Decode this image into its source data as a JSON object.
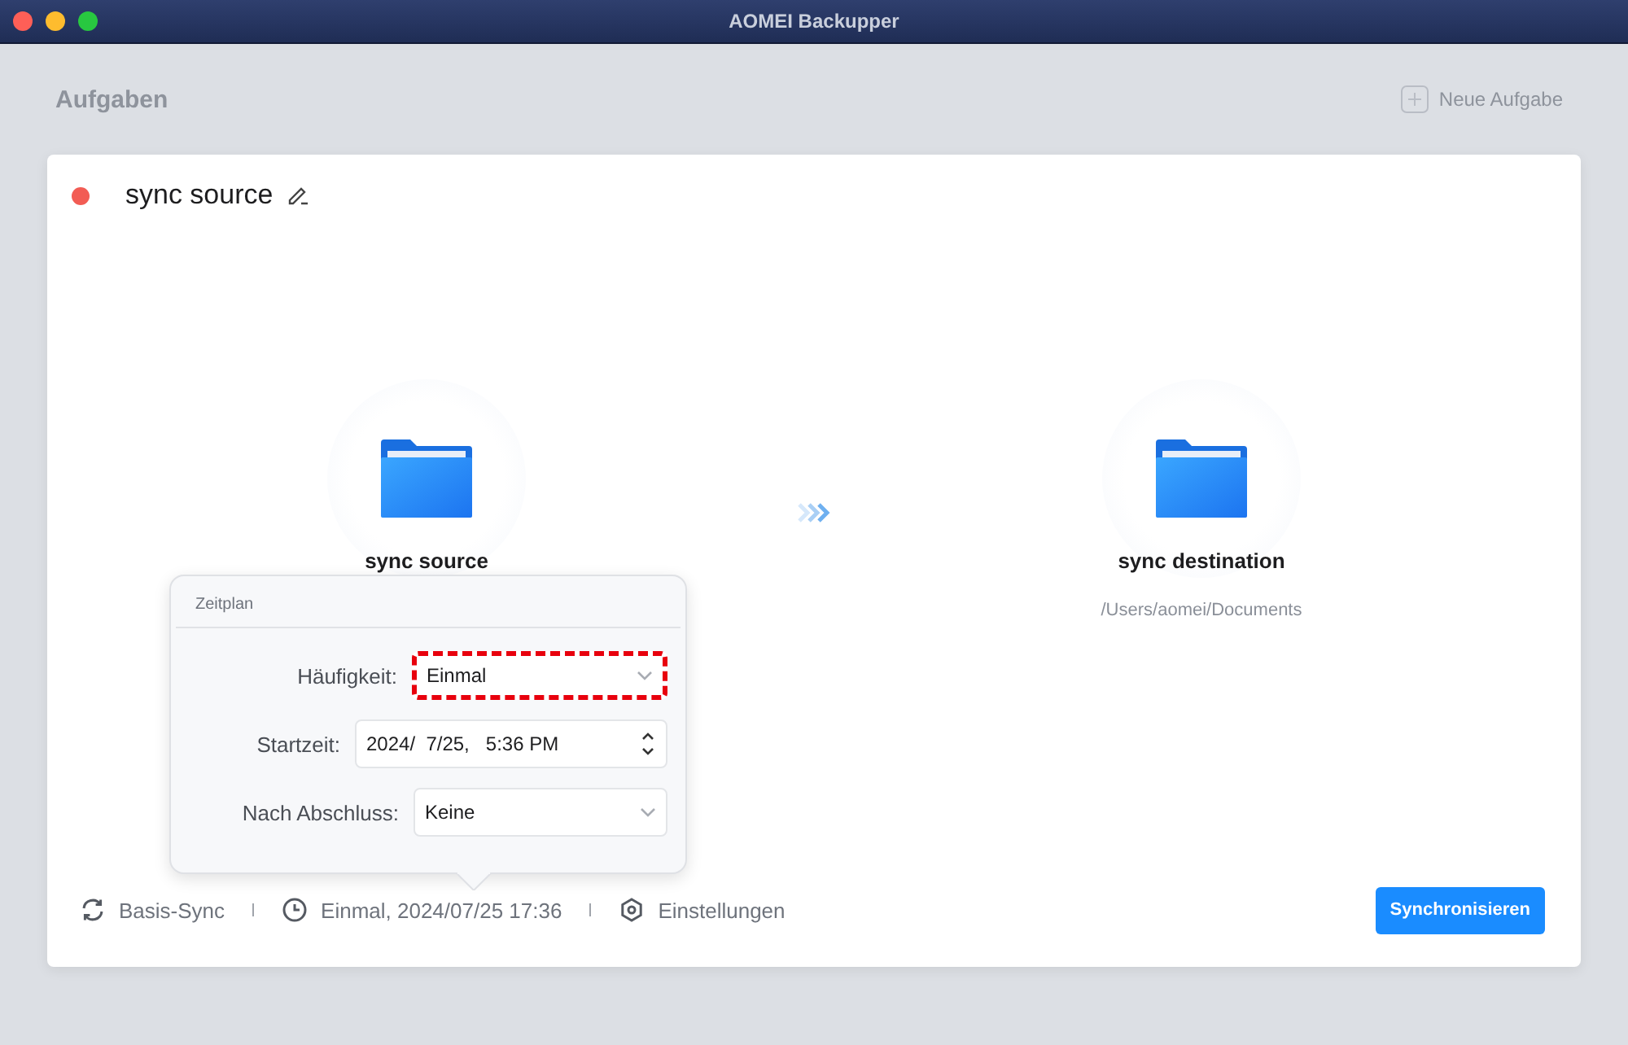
{
  "window": {
    "title": "AOMEI Backupper"
  },
  "page_header": {
    "title": "Aufgaben",
    "new_task": "Neue Aufgabe"
  },
  "task": {
    "name": "sync source"
  },
  "source": {
    "label": "sync source"
  },
  "destination": {
    "label": "sync destination",
    "path": "/Users/aomei/Documents"
  },
  "schedule_popover": {
    "title": "Zeitplan",
    "fields": [
      {
        "kind": "select",
        "label": "Häufigkeit:",
        "value": "Einmal",
        "highlighted": true
      },
      {
        "kind": "datetime",
        "label": "Startzeit:",
        "value": "2024/  7/25,   5:36 PM",
        "highlighted": false
      },
      {
        "kind": "select",
        "label": "Nach Abschluss:",
        "value": "Keine",
        "highlighted": false
      }
    ]
  },
  "footer": {
    "items": [
      {
        "kind": "sync",
        "label": "Basis-Sync"
      },
      {
        "kind": "clock",
        "label": "Einmal, 2024/07/25 17:36"
      },
      {
        "kind": "settings",
        "label": "Einstellungen"
      }
    ],
    "action": "Synchronisieren"
  }
}
